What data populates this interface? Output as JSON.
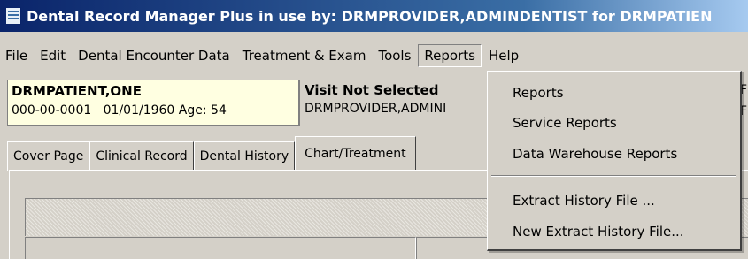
{
  "window": {
    "title": "Dental Record Manager Plus in use by: DRMPROVIDER,ADMINDENTIST for DRMPATIEN"
  },
  "menubar": {
    "items": [
      "File",
      "Edit",
      "Dental Encounter Data",
      "Treatment & Exam",
      "Tools",
      "Reports",
      "Help"
    ],
    "open": "Reports"
  },
  "patient": {
    "name": "DRMPATIENT,ONE",
    "ssn": "000-00-0001",
    "dob": "01/01/1960",
    "age_label": "Age:",
    "age": "54"
  },
  "visit": {
    "status": "Visit Not Selected",
    "provider": "DRMPROVIDER,ADMINI"
  },
  "tabs": [
    "Cover Page",
    "Clinical Record",
    "Dental History",
    "Chart/Treatment"
  ],
  "right_edge": {
    "line1": "F",
    "line2": "F"
  },
  "reports_menu": {
    "items": [
      "Reports",
      "Service Reports",
      "Data Warehouse Reports"
    ],
    "items2": [
      "Extract History File ...",
      "New Extract History File..."
    ]
  }
}
